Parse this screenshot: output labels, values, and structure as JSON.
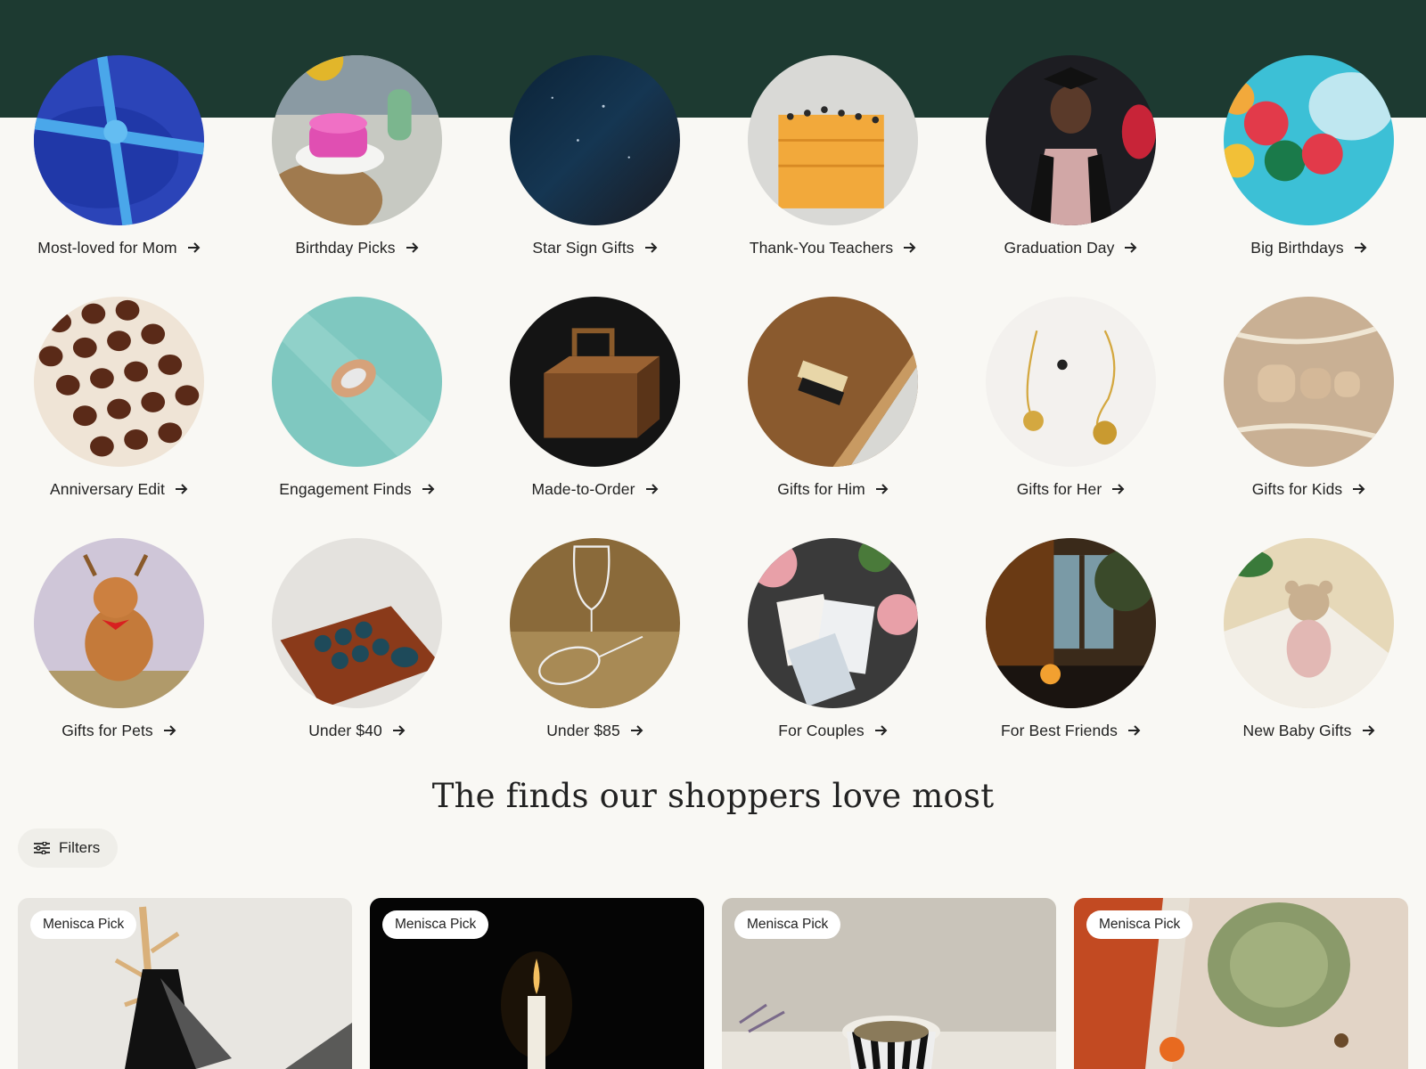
{
  "categories": [
    {
      "label": "Most-loved for Mom",
      "icon": "gift-wrap-icon"
    },
    {
      "label": "Birthday Picks",
      "icon": "cake-icon"
    },
    {
      "label": "Star Sign Gifts",
      "icon": "night-sky-icon"
    },
    {
      "label": "Thank-You Teachers",
      "icon": "pencils-icon"
    },
    {
      "label": "Graduation Day",
      "icon": "graduate-icon"
    },
    {
      "label": "Big Birthdays",
      "icon": "balloons-icon"
    },
    {
      "label": "Anniversary Edit",
      "icon": "chocolates-icon"
    },
    {
      "label": "Engagement Finds",
      "icon": "ring-icon"
    },
    {
      "label": "Made-to-Order",
      "icon": "wooden-box-icon"
    },
    {
      "label": "Gifts for Him",
      "icon": "brush-icon"
    },
    {
      "label": "Gifts for Her",
      "icon": "necklace-icon"
    },
    {
      "label": "Gifts for Kids",
      "icon": "wooden-elephants-icon"
    },
    {
      "label": "Gifts for Pets",
      "icon": "dog-icon"
    },
    {
      "label": "Under $40",
      "icon": "tea-set-icon"
    },
    {
      "label": "Under $85",
      "icon": "wine-glasses-icon"
    },
    {
      "label": "For Couples",
      "icon": "cards-icon"
    },
    {
      "label": "For Best Friends",
      "icon": "window-candle-icon"
    },
    {
      "label": "New Baby Gifts",
      "icon": "teddy-icon"
    }
  ],
  "section": {
    "title": "The finds our shoppers love most"
  },
  "filters": {
    "label": "Filters"
  },
  "products": [
    {
      "badge": "Menisca Pick"
    },
    {
      "badge": "Menisca Pick"
    },
    {
      "badge": "Menisca Pick"
    },
    {
      "badge": "Menisca Pick"
    }
  ],
  "colors": {
    "header": "#1d3a31",
    "background": "#f9f8f4"
  }
}
